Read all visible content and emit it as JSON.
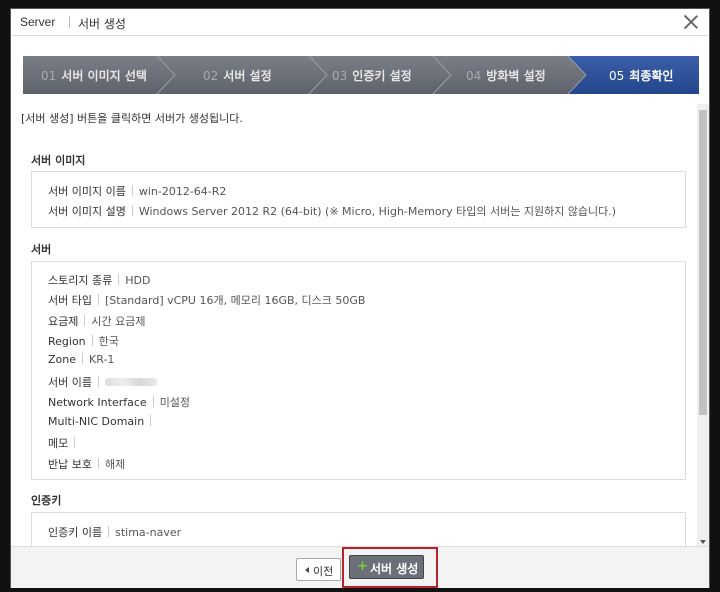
{
  "window": {
    "app": "Server",
    "title": "서버 생성"
  },
  "steps": [
    {
      "num": "01",
      "label": "서버 이미지 선택"
    },
    {
      "num": "02",
      "label": "서버 설정"
    },
    {
      "num": "03",
      "label": "인증키 설정"
    },
    {
      "num": "04",
      "label": "방화벽 설정"
    },
    {
      "num": "05",
      "label": "최종확인"
    }
  ],
  "intro": "[서버 생성] 버튼을 클릭하면 서버가 생성됩니다.",
  "image_section": {
    "title": "서버 이미지",
    "rows": [
      {
        "k": "서버 이미지 이름",
        "v": "win-2012-64-R2"
      },
      {
        "k": "서버 이미지 설명",
        "v": "Windows Server 2012 R2 (64-bit) (※ Micro, High-Memory 타입의 서버는 지원하지 않습니다.)"
      }
    ]
  },
  "server_section": {
    "title": "서버",
    "rows": [
      {
        "k": "스토리지 종류",
        "v": "HDD"
      },
      {
        "k": "서버 타입",
        "v": "[Standard] vCPU 16개, 메모리 16GB, 디스크 50GB"
      },
      {
        "k": "요금제",
        "v": "시간 요금제"
      },
      {
        "k": "Region",
        "v": "한국"
      },
      {
        "k": "Zone",
        "v": "KR-1"
      },
      {
        "k": "서버 이름",
        "v": ""
      },
      {
        "k": "Network Interface",
        "v": "미설정"
      },
      {
        "k": "Multi-NIC Domain",
        "v": ""
      },
      {
        "k": "메모",
        "v": ""
      },
      {
        "k": "반납 보호",
        "v": "해제"
      }
    ]
  },
  "auth_section": {
    "title": "인증키",
    "rows": [
      {
        "k": "인증키 이름",
        "v": "stima-naver"
      }
    ]
  },
  "footer": {
    "prev_label": "이전",
    "create_label": "서버 생성"
  },
  "colors": {
    "active_step": "#2d4f96",
    "inactive_step": "#6e727a",
    "highlight": "#b5262c",
    "plus": "#7bd13a"
  }
}
